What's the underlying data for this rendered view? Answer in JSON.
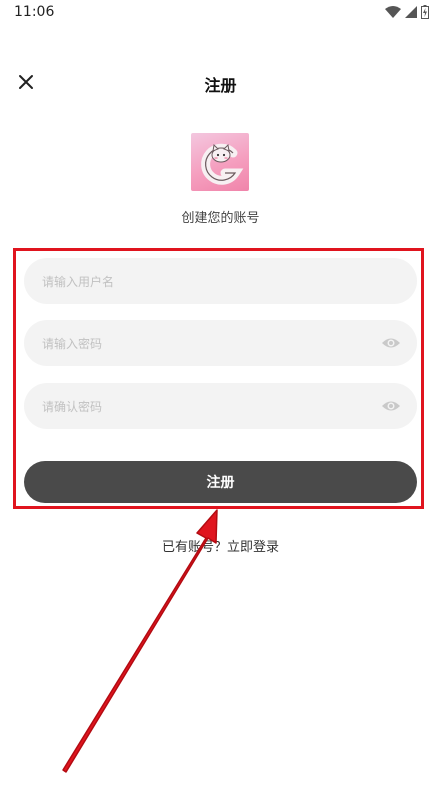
{
  "status_bar": {
    "time": "11:06"
  },
  "header": {
    "title": "注册"
  },
  "logo": {
    "label": "创建您的账号"
  },
  "form": {
    "username_placeholder": "请输入用户名",
    "password_placeholder": "请输入密码",
    "confirm_placeholder": "请确认密码",
    "submit_label": "注册"
  },
  "footer": {
    "login_prompt": "已有账号？立即登录"
  },
  "colors": {
    "highlight": "#e0141e",
    "button": "#4a4a4a",
    "field_bg": "#f3f3f3",
    "logo_gradient_start": "#f3c7df",
    "logo_gradient_end": "#f084aa"
  }
}
